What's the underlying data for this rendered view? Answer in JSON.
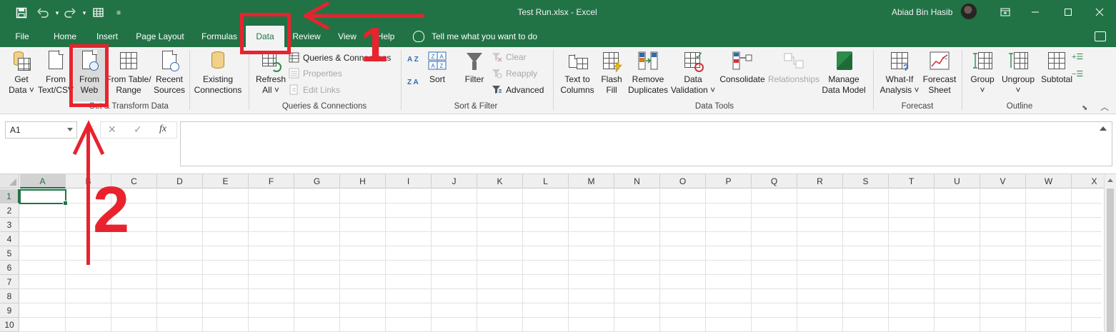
{
  "titlebar": {
    "save_icon": "save-icon",
    "undo_icon": "undo-icon",
    "redo_icon": "redo-icon",
    "customize_icon": "quick-access-icon",
    "title": "Test Run.xlsx  -  Excel",
    "user_name": "Abiad Bin Hasib",
    "controls": [
      "ribbon-display-icon",
      "minimize-icon",
      "maximize-icon",
      "close-icon"
    ]
  },
  "tabs": [
    {
      "label": "File"
    },
    {
      "label": "Home"
    },
    {
      "label": "Insert"
    },
    {
      "label": "Page Layout"
    },
    {
      "label": "Formulas"
    },
    {
      "label": "Data",
      "active": true
    },
    {
      "label": "Review"
    },
    {
      "label": "View"
    },
    {
      "label": "Help"
    }
  ],
  "tell_me": "Tell me what you want to do",
  "ribbon": {
    "get_transform": {
      "label": "Get & Transform Data",
      "get_data": [
        "Get",
        "Data"
      ],
      "from_text": [
        "From",
        "Text/CSV"
      ],
      "from_web": [
        "From",
        "Web"
      ],
      "from_table": [
        "From Table/",
        "Range"
      ],
      "recent_sources": [
        "Recent",
        "Sources"
      ],
      "existing_connections": [
        "Existing",
        "Connections"
      ]
    },
    "queries": {
      "label": "Queries & Connections",
      "refresh_all": [
        "Refresh",
        "All"
      ],
      "queries_connections": "Queries & Connections",
      "properties": "Properties",
      "edit_links": "Edit Links"
    },
    "sort_filter": {
      "label": "Sort & Filter",
      "sort": "Sort",
      "filter": "Filter",
      "clear": "Clear",
      "reapply": "Reapply",
      "advanced": "Advanced",
      "sort_az": "A Z",
      "sort_za": "Z A"
    },
    "data_tools": {
      "label": "Data Tools",
      "text_to_columns": [
        "Text to",
        "Columns"
      ],
      "flash_fill": [
        "Flash",
        "Fill"
      ],
      "remove_duplicates": [
        "Remove",
        "Duplicates"
      ],
      "data_validation": [
        "Data",
        "Validation"
      ],
      "consolidate": "Consolidate",
      "relationships": "Relationships",
      "manage_data_model": [
        "Manage",
        "Data Model"
      ]
    },
    "forecast": {
      "label": "Forecast",
      "what_if": [
        "What-If",
        "Analysis"
      ],
      "forecast_sheet": [
        "Forecast",
        "Sheet"
      ]
    },
    "outline": {
      "label": "Outline",
      "group": "Group",
      "ungroup": "Ungroup",
      "subtotal": "Subtotal"
    }
  },
  "formula_bar": {
    "name_box": "A1",
    "cancel": "✕",
    "enter": "✓",
    "fx": "fx",
    "value": ""
  },
  "grid": {
    "columns": [
      "A",
      "B",
      "C",
      "D",
      "E",
      "F",
      "G",
      "H",
      "I",
      "J",
      "K",
      "L",
      "M",
      "N",
      "O",
      "P",
      "Q",
      "R",
      "S",
      "T",
      "U",
      "V",
      "W",
      "X"
    ],
    "rows": [
      "1",
      "2",
      "3",
      "4",
      "5",
      "6",
      "7",
      "8",
      "9",
      "10"
    ],
    "active_cell": "A1"
  },
  "annotations": {
    "step1": "1",
    "step2": "2"
  },
  "colors": {
    "excel_green": "#217346",
    "annotation_red": "#e8232e"
  }
}
